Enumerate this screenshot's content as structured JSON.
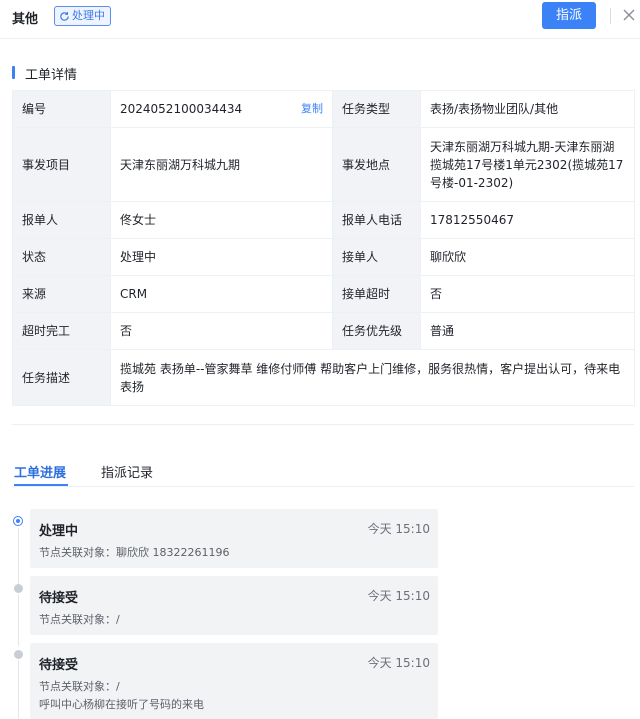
{
  "header": {
    "title": "其他",
    "status": "处理中",
    "assign_label": "指派"
  },
  "section": {
    "title": "工单详情"
  },
  "details": {
    "rows": [
      {
        "l1": "编号",
        "v1": "2024052100034434",
        "copy": "复制",
        "l2": "任务类型",
        "v2": "表扬/表扬物业团队/其他"
      },
      {
        "l1": "事发项目",
        "v1": "天津东丽湖万科城九期",
        "l2": "事发地点",
        "v2": "天津东丽湖万科城九期-天津东丽湖揽城苑17号楼1单元2302(揽城苑17号楼-01-2302)"
      },
      {
        "l1": "报单人",
        "v1": "佟女士",
        "l2": "报单人电话",
        "v2": "17812550467"
      },
      {
        "l1": "状态",
        "v1": "处理中",
        "l2": "接单人",
        "v2": "聊欣欣"
      },
      {
        "l1": "来源",
        "v1": "CRM",
        "l2": "接单超时",
        "v2": "否"
      },
      {
        "l1": "超时完工",
        "v1": "否",
        "l2": "任务优先级",
        "v2": "普通"
      }
    ],
    "desc_label": "任务描述",
    "desc_value": "揽城苑 表扬单--管家舞草 维修付师傅 帮助客户上门维修，服务很热情，客户提出认可，待来电表扬"
  },
  "tabs": [
    {
      "label": "工单进展",
      "active": true
    },
    {
      "label": "指派记录",
      "active": false
    }
  ],
  "timeline": [
    {
      "title": "处理中",
      "time": "今天 15:10",
      "lines": [
        "节点关联对象：聊欣欣 18322261196"
      ],
      "state": "active"
    },
    {
      "title": "待接受",
      "time": "今天 15:10",
      "lines": [
        "节点关联对象：/"
      ],
      "state": "done"
    },
    {
      "title": "待接受",
      "time": "今天 15:10",
      "lines": [
        "节点关联对象：/",
        "呼叫中心杨柳在接听了号码的来电"
      ],
      "state": "done"
    }
  ],
  "colors": {
    "accent": "#3b82f6",
    "label_bg": "#f2f3f6",
    "card_bg": "#f2f3f5"
  },
  "icons": {
    "status": "refresh-icon",
    "close": "close-icon"
  }
}
